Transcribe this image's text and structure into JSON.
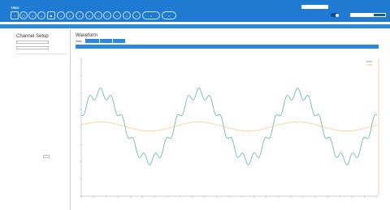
{
  "topbar": {
    "brand": "TREX",
    "brand_sub": "· · · · · ·",
    "toolbar_glyphs": [
      "↑",
      "▢",
      "○",
      "○",
      "■",
      "○",
      "○",
      "○",
      "○",
      "○",
      "○",
      "○",
      "○",
      "○",
      "○",
      "○"
    ],
    "toggle_label": "",
    "right_text": ""
  },
  "panel_bar": "",
  "left_panel": {
    "title": "Channel Setup"
  },
  "main": {
    "title": "Waveform",
    "view_label": "View"
  },
  "chart_data": {
    "type": "line",
    "title": "",
    "xlabel": "",
    "ylabel": "",
    "legend": "top-right",
    "grid": false,
    "series": [
      {
        "name": "",
        "color": "#2a9d8f",
        "shape": "sine with ripple",
        "periods": 3.0,
        "amplitude": 1.0,
        "offset": 0.0
      },
      {
        "name": "",
        "color": "#f0a030",
        "shape": "sine",
        "periods": 3.0,
        "amplitude": 0.12,
        "offset": 0.0
      }
    ]
  },
  "colors": {
    "topbar": "#1f7ad1",
    "accent": "#2b88dd"
  }
}
